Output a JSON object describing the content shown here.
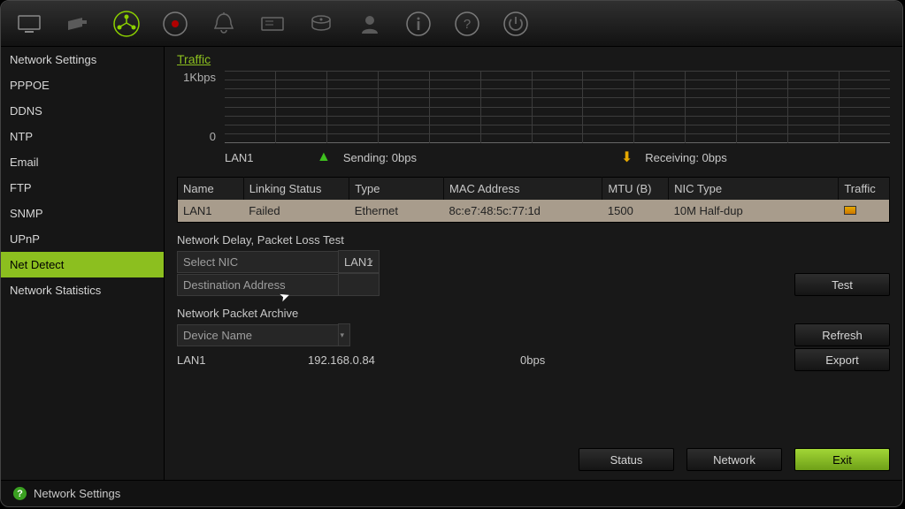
{
  "toolbar_icons": [
    "monitor",
    "camera",
    "network",
    "record",
    "alert",
    "decode",
    "hdd",
    "user",
    "info",
    "help",
    "power"
  ],
  "sidebar": {
    "items": [
      {
        "label": "Network Settings"
      },
      {
        "label": "PPPOE"
      },
      {
        "label": "DDNS"
      },
      {
        "label": "NTP"
      },
      {
        "label": "Email"
      },
      {
        "label": "FTP"
      },
      {
        "label": "SNMP"
      },
      {
        "label": "UPnP"
      },
      {
        "label": "Net Detect",
        "selected": true
      },
      {
        "label": "Network Statistics"
      }
    ]
  },
  "tab": {
    "label": "Traffic"
  },
  "graph": {
    "y_max": "1Kbps",
    "y_min": "0",
    "nic": "LAN1",
    "sending": "Sending: 0bps",
    "receiving": "Receiving: 0bps"
  },
  "table": {
    "headers": [
      "Name",
      "Linking Status",
      "Type",
      "MAC Address",
      "MTU (B)",
      "NIC Type",
      "Traffic"
    ],
    "row": {
      "name": "LAN1",
      "status": "Failed",
      "type": "Ethernet",
      "mac": "8c:e7:48:5c:77:1d",
      "mtu": "1500",
      "nictype": "10M Half-dup"
    }
  },
  "section1": {
    "title": "Network Delay, Packet Loss Test",
    "nic_label": "Select NIC",
    "nic_value": "LAN1",
    "dest_label": "Destination Address",
    "dest_value": "",
    "test_btn": "Test"
  },
  "section2": {
    "title": "Network Packet Archive",
    "dev_label": "Device Name",
    "dev_value": "",
    "refresh_btn": "Refresh",
    "export_btn": "Export",
    "info_nic": "LAN1",
    "info_ip": "192.168.0.84",
    "info_rate": "0bps"
  },
  "buttons": {
    "status": "Status",
    "network": "Network",
    "exit": "Exit"
  },
  "footer": {
    "title": "Network Settings"
  },
  "chart_data": {
    "type": "line",
    "title": "Traffic",
    "ylabel": "",
    "ylim": [
      0,
      1
    ],
    "y_unit": "Kbps",
    "categories": [
      "LAN1"
    ],
    "series": [
      {
        "name": "Sending",
        "values": [
          0
        ],
        "unit": "bps"
      },
      {
        "name": "Receiving",
        "values": [
          0
        ],
        "unit": "bps"
      }
    ]
  }
}
